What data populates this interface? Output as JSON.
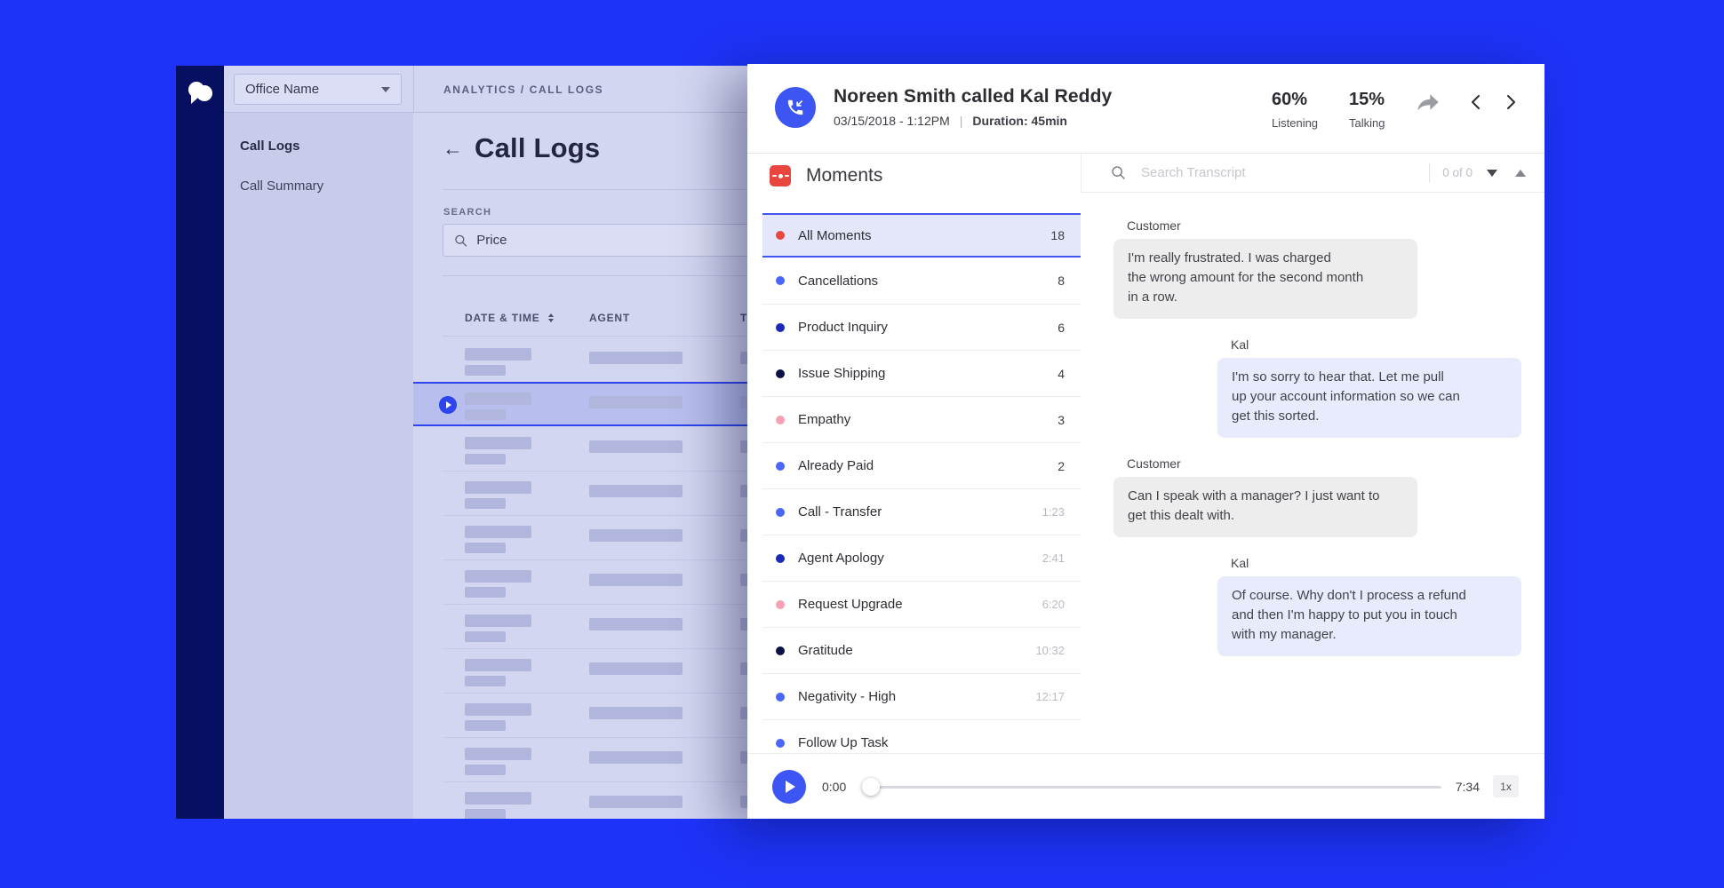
{
  "app": {
    "background_color": "#1e33f8",
    "accent_blue": "#3d55f2",
    "moments_red": "#e8463e"
  },
  "left_window": {
    "office_selector": {
      "label": "Office Name"
    },
    "breadcrumb": "ANALYTICS / CALL LOGS",
    "sidebar": {
      "items": [
        {
          "label": "Call Logs"
        },
        {
          "label": "Call Summary"
        }
      ]
    },
    "page": {
      "title": "Call Logs",
      "search_label": "SEARCH",
      "search_value": "Price",
      "table": {
        "columns": [
          "DATE & TIME",
          "AGENT",
          "T"
        ],
        "skeleton_row_count": 11,
        "selected_row_index": 2
      }
    }
  },
  "detail_panel": {
    "header": {
      "title": "Noreen Smith called Kal Reddy",
      "datetime": "03/15/2018 - 1:12PM",
      "separator": "|",
      "duration": "Duration: 45min",
      "stats": [
        {
          "value": "60%",
          "label": "Listening"
        },
        {
          "value": "15%",
          "label": "Talking"
        }
      ]
    },
    "moments": {
      "title": "Moments",
      "items": [
        {
          "label": "All Moments",
          "value": "18",
          "dot": "#e8463e"
        },
        {
          "label": "Cancellations",
          "value": "8",
          "dot": "#4a66f5"
        },
        {
          "label": "Product Inquiry",
          "value": "6",
          "dot": "#1b29b6"
        },
        {
          "label": "Issue Shipping",
          "value": "4",
          "dot": "#0c1145"
        },
        {
          "label": "Empathy",
          "value": "3",
          "dot": "#f8a0b4"
        },
        {
          "label": "Already Paid",
          "value": "2",
          "dot": "#4a66f5"
        },
        {
          "label": "Call - Transfer",
          "value": "1:23",
          "dot": "#4a66f5"
        },
        {
          "label": "Agent Apology",
          "value": "2:41",
          "dot": "#1b29b6"
        },
        {
          "label": "Request Upgrade",
          "value": "6:20",
          "dot": "#f8a0b4"
        },
        {
          "label": "Gratitude",
          "value": "10:32",
          "dot": "#0c1145"
        },
        {
          "label": "Negativity - High",
          "value": "12:17",
          "dot": "#4a66f5"
        },
        {
          "label": "Follow Up Task",
          "value": "",
          "dot": "#4a66f5"
        }
      ]
    },
    "transcript": {
      "search_placeholder": "Search Transcript",
      "result_counter": "0 of 0",
      "messages": [
        {
          "speaker": "Customer",
          "text": "I'm really frustrated. I was charged\nthe wrong amount for the second month\nin a row."
        },
        {
          "speaker": "Kal",
          "text": "I'm so sorry to hear that. Let me pull\nup your account information so we can\nget this sorted."
        },
        {
          "speaker": "Customer",
          "text": "Can I speak with a manager? I just want to\nget this dealt with."
        },
        {
          "speaker": "Kal",
          "text": "Of course. Why don't I process a refund\nand then I'm happy to put you in touch\nwith my manager."
        }
      ]
    },
    "player": {
      "current_time": "0:00",
      "total_time": "7:34",
      "speed": "1x"
    }
  }
}
